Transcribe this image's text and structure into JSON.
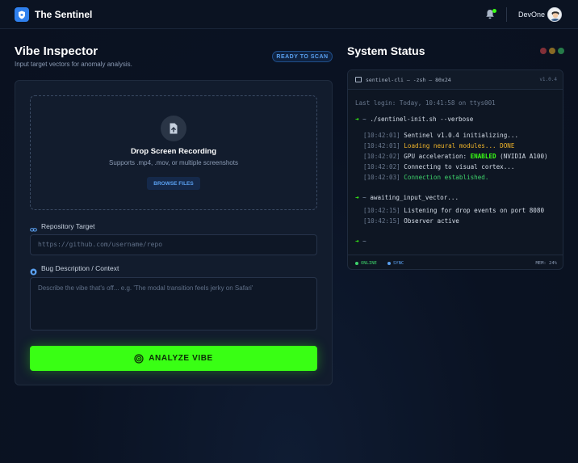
{
  "header": {
    "app_title": "The Sentinel",
    "user_name": "DevOne",
    "logo_icon": "shield-icon",
    "notification_icon": "bell-icon"
  },
  "inspector": {
    "title": "Vibe Inspector",
    "subtitle": "Input target vectors for anomaly analysis.",
    "status_badge": "READY TO SCAN",
    "dropzone": {
      "title": "Drop Screen Recording",
      "subtitle": "Supports .mp4, .mov, or multiple screenshots",
      "browse_label": "BROWSE FILES"
    },
    "repo": {
      "label": "Repository Target",
      "placeholder": "https://github.com/username/repo"
    },
    "bug": {
      "label": "Bug Description / Context",
      "placeholder": "Describe the vibe that's off... e.g. 'The modal transition feels jerky on Safari'"
    },
    "analyze_label": "ANALYZE VIBE"
  },
  "system": {
    "title": "System Status",
    "window_dot_colors": [
      "#e5484d",
      "#f0b429",
      "#3ed36b"
    ],
    "terminal": {
      "title": "sentinel-cli — -zsh — 80x24",
      "version": "v1.0.4",
      "last_login": "Last login: Today, 10:41:58 on ttys001",
      "prompt_arrow": "➜",
      "prompt_tilde": "~",
      "cmd1": "./sentinel-init.sh --verbose",
      "log1": [
        {
          "ts": "[10:42:01]",
          "msg": "Sentinel v1.0.4 initializing..."
        },
        {
          "ts": "[10:42:01]",
          "msg": "Loading neural modules... DONE"
        },
        {
          "ts": "[10:42:02]",
          "msg_a": "GPU acceleration: ",
          "msg_b": "ENABLED",
          "msg_c": " (NVIDIA A100)"
        },
        {
          "ts": "[10:42:02]",
          "msg": "Connecting to visual cortex..."
        },
        {
          "ts": "[10:42:03]",
          "msg": "Connection established."
        }
      ],
      "cmd2": "awaiting_input_vector...",
      "log2": [
        {
          "ts": "[10:42:15]",
          "msg": "Listening for drop events on port 8080"
        },
        {
          "ts": "[10:42:15]",
          "msg": "Observer active"
        }
      ],
      "footer": {
        "online": "ONLINE",
        "sync": "SYNC",
        "mem": "MEM: 24%"
      }
    }
  },
  "colors": {
    "accent_green": "#39ff14",
    "accent_blue": "#2f80ed",
    "background": "#0a1222"
  }
}
